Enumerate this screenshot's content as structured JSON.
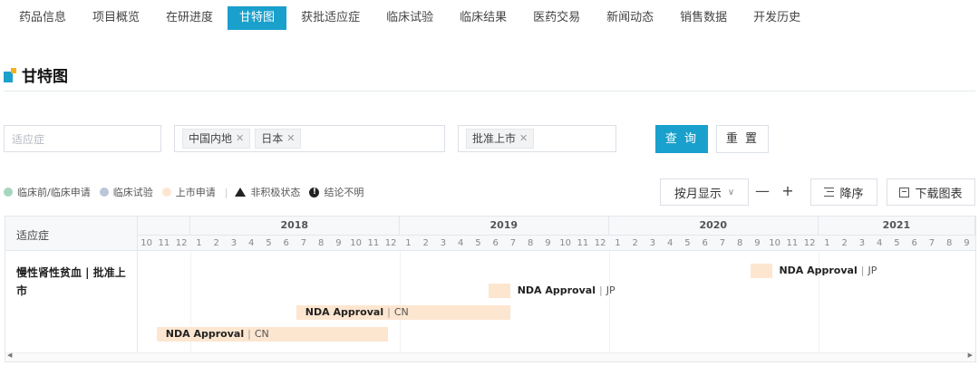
{
  "tabs": [
    {
      "label": "药品信息",
      "active": false
    },
    {
      "label": "项目概览",
      "active": false
    },
    {
      "label": "在研进度",
      "active": false
    },
    {
      "label": "甘特图",
      "active": true
    },
    {
      "label": "获批适应症",
      "active": false
    },
    {
      "label": "临床试验",
      "active": false
    },
    {
      "label": "临床结果",
      "active": false
    },
    {
      "label": "医药交易",
      "active": false
    },
    {
      "label": "新闻动态",
      "active": false
    },
    {
      "label": "销售数据",
      "active": false
    },
    {
      "label": "开发历史",
      "active": false
    }
  ],
  "section": {
    "title": "甘特图"
  },
  "filters": {
    "indication_placeholder": "适应症",
    "regions": [
      "中国内地",
      "日本"
    ],
    "statuses": [
      "批准上市"
    ],
    "query_label": "查 询",
    "reset_label": "重 置"
  },
  "legend": {
    "items": [
      {
        "label": "临床前/临床申请",
        "color": "#a6d6bf"
      },
      {
        "label": "临床试验",
        "color": "#b9c7d9"
      },
      {
        "label": "上市申请",
        "color": "#fde6d0"
      }
    ],
    "separator": "|",
    "inactive_label": "非积极状态",
    "unclear_label": "结论不明"
  },
  "tools": {
    "view_mode": "按月显示",
    "zoom_out": "—",
    "zoom_in": "+",
    "sort_label": "降序",
    "download_label": "下载图表"
  },
  "gantt": {
    "left_header": "适应症",
    "row_label": "慢性肾性贫血 | 批准上市",
    "timeline_start": {
      "year": 2017,
      "month": 10
    },
    "visible_months": 48,
    "years": [
      {
        "label": "2018",
        "year": 2018
      },
      {
        "label": "2019",
        "year": 2019
      },
      {
        "label": "2020",
        "year": 2020
      },
      {
        "label": "2021",
        "year": 2021
      }
    ],
    "bars": [
      {
        "label": "NDA Approval",
        "region": "JP",
        "start": "2020-09",
        "end": "2020-10"
      },
      {
        "label": "NDA Approval",
        "region": "JP",
        "start": "2019-06",
        "end": "2019-07"
      },
      {
        "label": "NDA Approval",
        "region": "CN",
        "start": "2018-07",
        "end": "2019-07"
      },
      {
        "label": "NDA Approval",
        "region": "CN",
        "start": "2017-11",
        "end": "2018-12"
      }
    ]
  },
  "colors": {
    "accent": "#1aa0cc",
    "bar_fill": "#fde6d0"
  }
}
